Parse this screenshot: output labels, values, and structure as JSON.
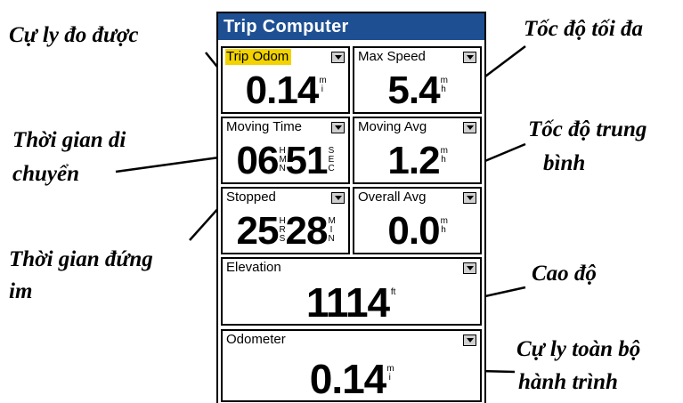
{
  "window": {
    "title": "Trip Computer"
  },
  "fields": {
    "trip_odom": {
      "label": "Trip Odom",
      "value": "0.14",
      "unit": "mi"
    },
    "max_speed": {
      "label": "Max Speed",
      "value": "5.4",
      "unit": "mh"
    },
    "moving_time": {
      "label": "Moving Time",
      "value_a": "06",
      "unit_a": "HMN",
      "value_b": "51",
      "unit_b": "SEC"
    },
    "moving_avg": {
      "label": "Moving Avg",
      "value": "1.2",
      "unit": "mh"
    },
    "stopped": {
      "label": "Stopped",
      "value_a": "25",
      "unit_a": "HRS",
      "value_b": "28",
      "unit_b": "MIN"
    },
    "overall_avg": {
      "label": "Overall Avg",
      "value": "0.0",
      "unit": "mh"
    },
    "elevation": {
      "label": "Elevation",
      "value": "1114",
      "unit": "ft"
    },
    "odometer": {
      "label": "Odometer",
      "value": "0.14",
      "unit": "mi"
    }
  },
  "annotations": {
    "trip_distance": "Cự ly đo được",
    "max_speed": "Tốc độ tối đa",
    "moving_time_1": "Thời gian di",
    "moving_time_2": "chuyển",
    "avg_speed_1": "Tốc độ trung",
    "avg_speed_2": "bình",
    "stopped_time_1": "Thời gian đứng",
    "stopped_time_2": "im",
    "elevation": "Cao độ",
    "odometer_1": "Cự ly toàn bộ",
    "odometer_2": "hành trình"
  },
  "colors": {
    "titlebar": "#1d4f92",
    "highlight": "#f2d300"
  },
  "selected_field": "trip_odom"
}
